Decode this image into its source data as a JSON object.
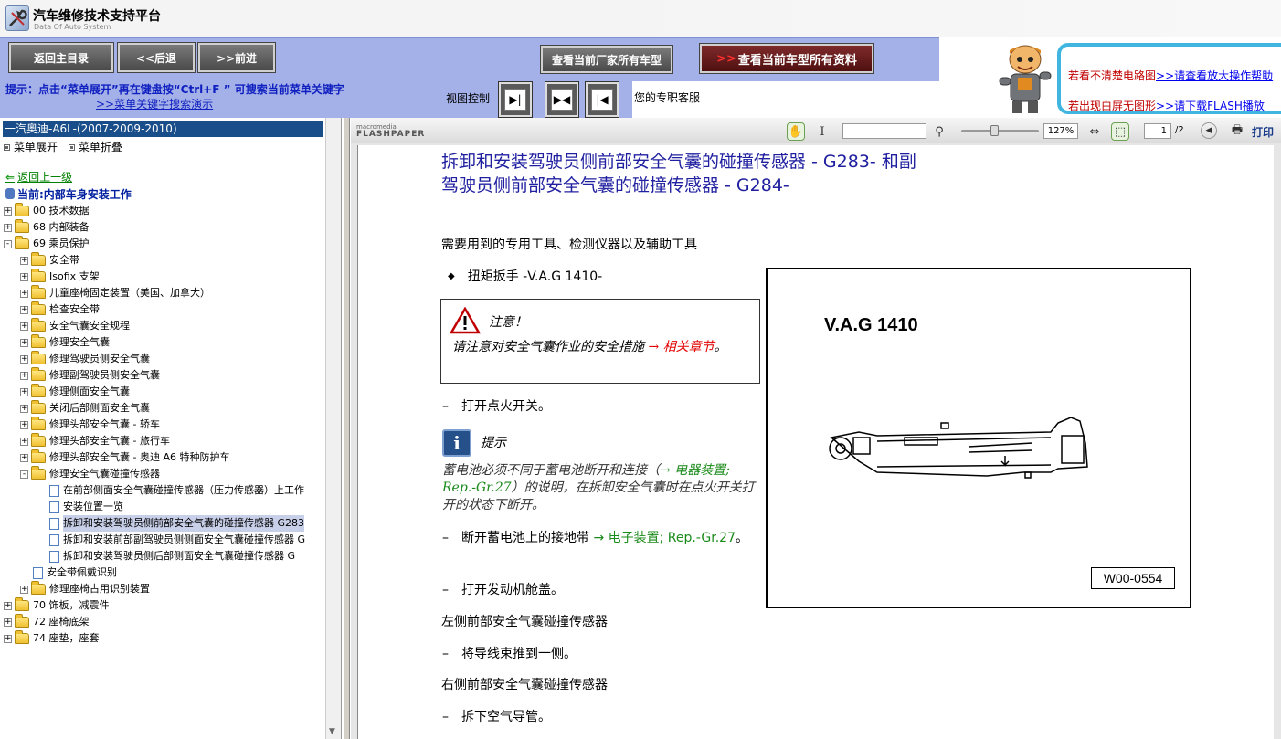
{
  "app": {
    "title": "汽车维修技术支持平台",
    "subtitle": "Data Of Auto System"
  },
  "toolbar": {
    "home": "返回主目录",
    "back": "<<后退",
    "forward": ">>前进",
    "all_models": "查看当前厂家所有车型",
    "all_docs_arrow": ">>",
    "all_docs": "查看当前车型所有资料"
  },
  "help": {
    "line1_red": "若看不清楚电路图",
    "line1_link": ">>请查看放大操作帮助",
    "line2_red": "若出现白屏无图形",
    "line2_link_prefix": ">>请下载",
    "line2_link": "FLASH播放"
  },
  "hint": {
    "text": "提示：点击“菜单展开”再在键盘按“Ctrl+F ” 可搜索当前菜单关键字",
    "demo_link": ">>菜单关键字搜索演示"
  },
  "view": {
    "label": "视图控制"
  },
  "service": {
    "text": "您的专职客服"
  },
  "tree": {
    "header": "一汽奥迪-A6L-(2007-2009-2010)",
    "expand": "菜单展开",
    "collapse": "菜单折叠",
    "back": "返回上一级",
    "current": "当前:内部车身安装工作",
    "nodes": [
      {
        "label": "00 技术数据",
        "indent": 0,
        "type": "folder",
        "exp": "+"
      },
      {
        "label": "68 内部装备",
        "indent": 0,
        "type": "folder",
        "exp": "+"
      },
      {
        "label": "69 乘员保护",
        "indent": 0,
        "type": "folder",
        "exp": "-"
      },
      {
        "label": "安全带",
        "indent": 1,
        "type": "folder",
        "exp": "+"
      },
      {
        "label": "Isofix 支架",
        "indent": 1,
        "type": "folder",
        "exp": "+"
      },
      {
        "label": "儿童座椅固定装置（美国、加拿大）",
        "indent": 1,
        "type": "folder",
        "exp": "+"
      },
      {
        "label": "检查安全带",
        "indent": 1,
        "type": "folder",
        "exp": "+"
      },
      {
        "label": "安全气囊安全规程",
        "indent": 1,
        "type": "folder",
        "exp": "+"
      },
      {
        "label": "修理安全气囊",
        "indent": 1,
        "type": "folder",
        "exp": "+"
      },
      {
        "label": "修理驾驶员侧安全气囊",
        "indent": 1,
        "type": "folder",
        "exp": "+"
      },
      {
        "label": "修理副驾驶员侧安全气囊",
        "indent": 1,
        "type": "folder",
        "exp": "+"
      },
      {
        "label": "修理侧面安全气囊",
        "indent": 1,
        "type": "folder",
        "exp": "+"
      },
      {
        "label": "关闭后部侧面安全气囊",
        "indent": 1,
        "type": "folder",
        "exp": "+"
      },
      {
        "label": "修理头部安全气囊 - 轿车",
        "indent": 1,
        "type": "folder",
        "exp": "+"
      },
      {
        "label": "修理头部安全气囊 - 旅行车",
        "indent": 1,
        "type": "folder",
        "exp": "+"
      },
      {
        "label": "修理头部安全气囊 - 奥迪 A6 特种防护车",
        "indent": 1,
        "type": "folder",
        "exp": "+"
      },
      {
        "label": "修理安全气囊碰撞传感器",
        "indent": 1,
        "type": "folder",
        "exp": "-"
      },
      {
        "label": "在前部侧面安全气囊碰撞传感器（压力传感器）上工作",
        "indent": 2,
        "type": "page"
      },
      {
        "label": "安装位置一览",
        "indent": 2,
        "type": "page"
      },
      {
        "label": "拆卸和安装驾驶员侧前部安全气囊的碰撞传感器 G283",
        "indent": 2,
        "type": "page",
        "selected": true
      },
      {
        "label": "拆卸和安装前部副驾驶员侧侧面安全气囊碰撞传感器 G",
        "indent": 2,
        "type": "page"
      },
      {
        "label": "拆卸和安装驾驶员侧后部侧面安全气囊碰撞传感器 G",
        "indent": 2,
        "type": "page"
      },
      {
        "label": "安全带佩戴识别",
        "indent": 1,
        "type": "page"
      },
      {
        "label": "修理座椅占用识别装置",
        "indent": 1,
        "type": "folder",
        "exp": "+"
      },
      {
        "label": "70 饰板，减震件",
        "indent": 0,
        "type": "folder",
        "exp": "+"
      },
      {
        "label": "72 座椅底架",
        "indent": 0,
        "type": "folder",
        "exp": "+"
      },
      {
        "label": "74 座垫，座套",
        "indent": 0,
        "type": "folder",
        "exp": "+"
      }
    ]
  },
  "viewer": {
    "brand_small": "macromedia",
    "brand": "FLASHPAPER",
    "zoom": "127%",
    "page": "1",
    "page_total": "/2",
    "print": "打印"
  },
  "doc": {
    "title": "拆卸和安装驾驶员侧前部安全气囊的碰撞传感器 - G283- 和副驾驶员侧前部安全气囊的碰撞传感器 - G284-",
    "tools_heading": "需要用到的专用工具、检测仪器以及辅助工具",
    "wrench": "扭矩扳手 -V.A.G 1410-",
    "caution_title": "注意！",
    "caution_text": "请注意对安全气囊作业的安全措施",
    "caution_link": "→ 相关章节",
    "step_ignition_on": "打开点火开关。",
    "note_title": "提示",
    "note_text_a": "蓄电池必须不同于蓄电池断开和连接（",
    "note_link": "→ 电器装置; Rep.-Gr.27",
    "note_text_b": "）的说明，在拆卸安全气囊时在点火开关打开的状态下断开。",
    "step_battery_a": "断开蓄电池上的接地带",
    "step_battery_link": "→ 电子装置; Rep.-Gr.27",
    "step_battery_b": "。",
    "step_hood": "打开发动机舱盖。",
    "left_sensor_heading": "左侧前部安全气囊碰撞传感器",
    "step_harness": "将导线束推到一侧。",
    "right_sensor_heading": "右侧前部安全气囊碰撞传感器",
    "step_duct": "拆下空气导管。",
    "figure_label": "V.A.G 1410",
    "figure_code": "W00-0554"
  }
}
